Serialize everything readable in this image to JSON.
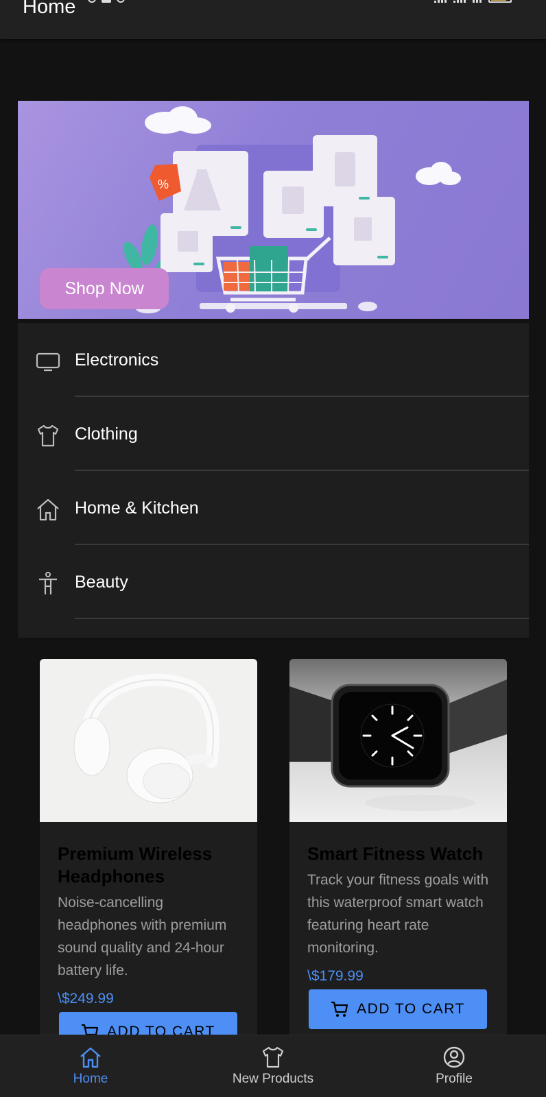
{
  "app_bar": {
    "title": "Home"
  },
  "banner": {
    "cta_label": "Shop Now"
  },
  "categories": [
    {
      "label": "Electronics",
      "icon": "tv-icon"
    },
    {
      "label": "Clothing",
      "icon": "shirt-icon"
    },
    {
      "label": "Home & Kitchen",
      "icon": "home-icon"
    },
    {
      "label": "Beauty",
      "icon": "person-icon"
    }
  ],
  "products": [
    {
      "title": "Premium Wireless Headphones",
      "description": "Noise-cancelling headphones with premium sound quality and 24-hour battery life.",
      "price": "\\$249.99",
      "button_label": "ADD TO CART",
      "image": "headphones-image"
    },
    {
      "title": "Smart Fitness Watch",
      "description": "Track your fitness goals with this waterproof smart watch featuring heart rate monitoring.",
      "price": "\\$179.99",
      "button_label": "ADD TO CART",
      "image": "smartwatch-image"
    }
  ],
  "bottom_nav": [
    {
      "label": "Home",
      "icon": "home-icon",
      "active": true
    },
    {
      "label": "New Products",
      "icon": "shirt-icon",
      "active": false
    },
    {
      "label": "Profile",
      "icon": "account-circle-icon",
      "active": false
    }
  ],
  "colors": {
    "accent": "#4d8ff5",
    "background": "#121212",
    "surface": "#1e1e1e",
    "banner_button": "#c985d0"
  }
}
